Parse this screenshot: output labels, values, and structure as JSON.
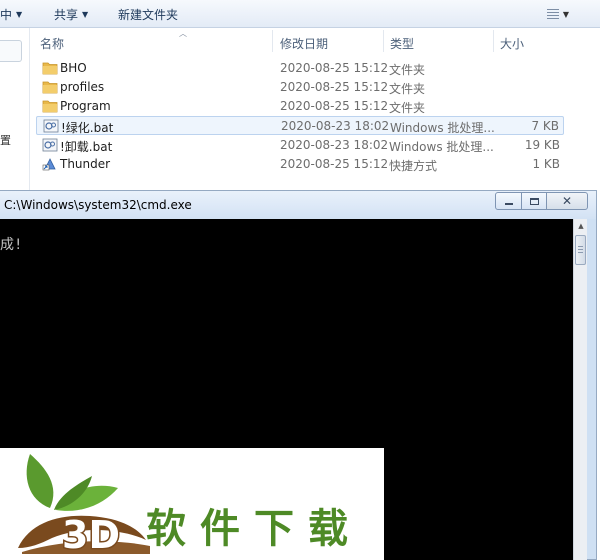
{
  "toolbar": {
    "partial_left_label": "中",
    "share_label": "共享",
    "new_folder_label": "新建文件夹"
  },
  "nav": {
    "partial_glyph": "置"
  },
  "columns": {
    "name": "名称",
    "date_modified": "修改日期",
    "type": "类型",
    "size": "大小"
  },
  "files": [
    {
      "name": "BHO",
      "date": "2020-08-25 15:12",
      "type": "文件夹",
      "size": "",
      "icon": "folder-icon",
      "selected": false
    },
    {
      "name": "profiles",
      "date": "2020-08-25 15:12",
      "type": "文件夹",
      "size": "",
      "icon": "folder-icon",
      "selected": false
    },
    {
      "name": "Program",
      "date": "2020-08-25 15:12",
      "type": "文件夹",
      "size": "",
      "icon": "folder-icon",
      "selected": false
    },
    {
      "name": "!绿化.bat",
      "date": "2020-08-23 18:02",
      "type": "Windows 批处理...",
      "size": "7 KB",
      "icon": "batch-file-icon",
      "selected": true
    },
    {
      "name": "!卸载.bat",
      "date": "2020-08-23 18:02",
      "type": "Windows 批处理...",
      "size": "19 KB",
      "icon": "batch-file-icon",
      "selected": false
    },
    {
      "name": "Thunder",
      "date": "2020-08-25 15:12",
      "type": "快捷方式",
      "size": "1 KB",
      "icon": "shortcut-icon",
      "selected": false
    }
  ],
  "cmd": {
    "title": "C:\\Windows\\system32\\cmd.exe",
    "console_text": "成!"
  },
  "watermark": {
    "text": "3D软件下载"
  },
  "colors": {
    "folder": "#e8b84a",
    "selection": "#eef5fd",
    "console_bg": "#000000",
    "watermark_brown": "#7a4a1e",
    "watermark_green": "#5a9a2e"
  }
}
